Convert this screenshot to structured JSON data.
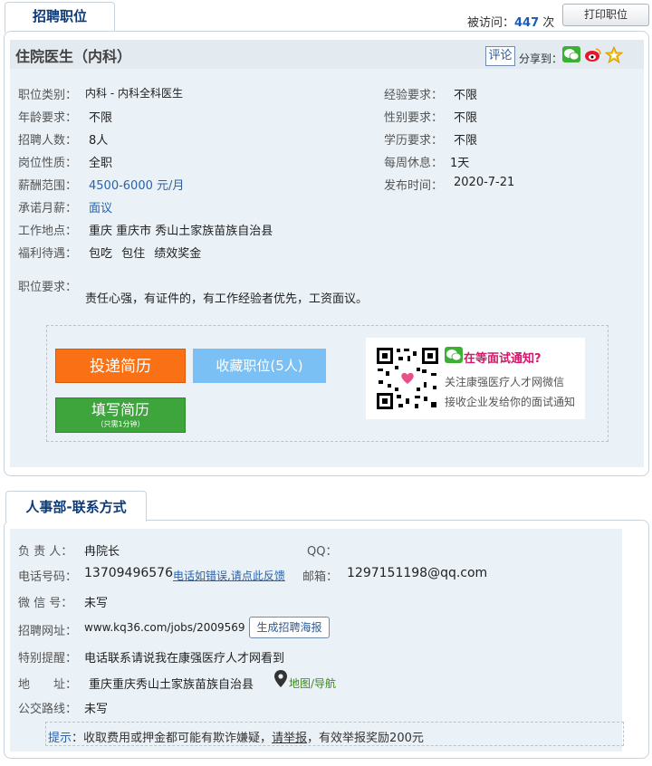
{
  "top": {
    "tab_label": "招聘职位",
    "visits_prefix": "被访问：",
    "visits_count": "447",
    "visits_suffix": " 次",
    "print_label": "打印职位"
  },
  "job": {
    "title": "住院医生（内科）",
    "comment_label": "评论",
    "share_label": "分享到：",
    "fields_left": [
      {
        "label": "职位类别：",
        "value": "内科 - 内科全科医生"
      },
      {
        "label": "年龄要求：",
        "value": "不限"
      },
      {
        "label": "招聘人数：",
        "value": "8人"
      },
      {
        "label": "岗位性质：",
        "value": "全职"
      },
      {
        "label": "薪酬范围：",
        "value": "4500-6000 元/月"
      },
      {
        "label": "承诺月薪：",
        "value": "面议"
      },
      {
        "label": "工作地点：",
        "value": "重庆 重庆市 秀山土家族苗族自治县"
      },
      {
        "label": "福利待遇：",
        "value": "包吃  包住  绩效奖金"
      }
    ],
    "fields_right": [
      {
        "label": "经验要求：",
        "value": "不限"
      },
      {
        "label": "性别要求：",
        "value": "不限"
      },
      {
        "label": "学历要求：",
        "value": "不限"
      },
      {
        "label": "每周休息：",
        "value": "1天"
      },
      {
        "label": "发布时间：",
        "value": "2020-7-21"
      }
    ],
    "req_label": "职位要求：",
    "req_text": "责任心强，有证件的，有工作经验者优先，工资面议。",
    "apply_label": "投递简历",
    "collect_label": "收藏职位(5人)",
    "fill_label": "填写简历",
    "fill_sub": "（只需1分钟）",
    "qr_title": "在等面试通知?",
    "qr_line1": "关注康强医疗人才网微信",
    "qr_line2": "接收企业发给你的面试通知"
  },
  "contact": {
    "tab_label": "人事部-联系方式",
    "person_label": "负 责 人：",
    "person_value": "冉院长",
    "qq_label": "QQ：",
    "phone_label": "电话号码：",
    "phone_value": "13709496576",
    "phone_feedback": "电话如错误,请点此反馈",
    "email_label": "邮箱：",
    "email_value": "1297151198@qq.com",
    "wechat_label": "微 信 号：",
    "wechat_value": "未写",
    "url_label": "招聘网址：",
    "url_value": "www.kq36.com/jobs/2009569",
    "poster_label": "生成招聘海报",
    "notice_label": "特别提醒：",
    "notice_value": "电话联系请说我在康强医疗人才网看到",
    "addr_label": "地　　址：",
    "addr_value": "重庆重庆秀山土家族苗族自治县",
    "map_label": "地图/导航",
    "bus_label": "公交路线：",
    "bus_value": "未写",
    "tip_label": "提示",
    "tip_text1": "：收取费用或押金都可能有欺诈嫌疑，",
    "tip_report": "请举报",
    "tip_text2": "，有效举报奖励200元"
  }
}
